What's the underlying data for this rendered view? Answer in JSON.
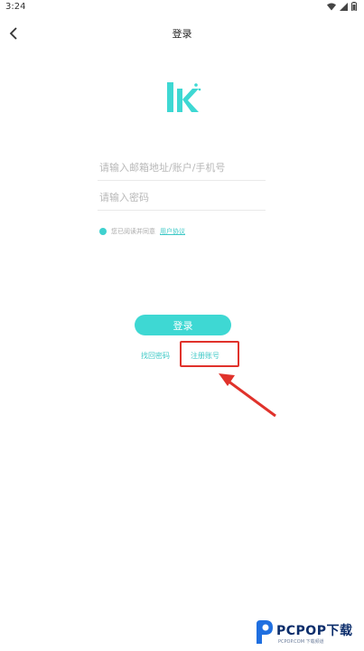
{
  "status_bar": {
    "time": "3:24",
    "icons": [
      "wifi-icon",
      "signal-icon",
      "battery-icon"
    ]
  },
  "nav": {
    "title": "登录",
    "back_icon": "chevron-left-icon"
  },
  "logo": {
    "icon": "app-logo-icon",
    "color": "#3ed8d3"
  },
  "form": {
    "account_placeholder": "请输入邮箱地址/账户/手机号",
    "password_placeholder": "请输入密码"
  },
  "agreement": {
    "prefix": "您已阅读并同意",
    "link": "用户协议"
  },
  "login_button": "登录",
  "links": {
    "forgot": "找回密码",
    "register": "注册账号"
  },
  "annotation": {
    "box_color": "#e0322b",
    "arrow_color": "#e0322b"
  },
  "watermark": {
    "text": "PCPOP下载",
    "sub": "PCPOP.COM 下载频道"
  },
  "colors": {
    "accent": "#3ed8d3"
  }
}
